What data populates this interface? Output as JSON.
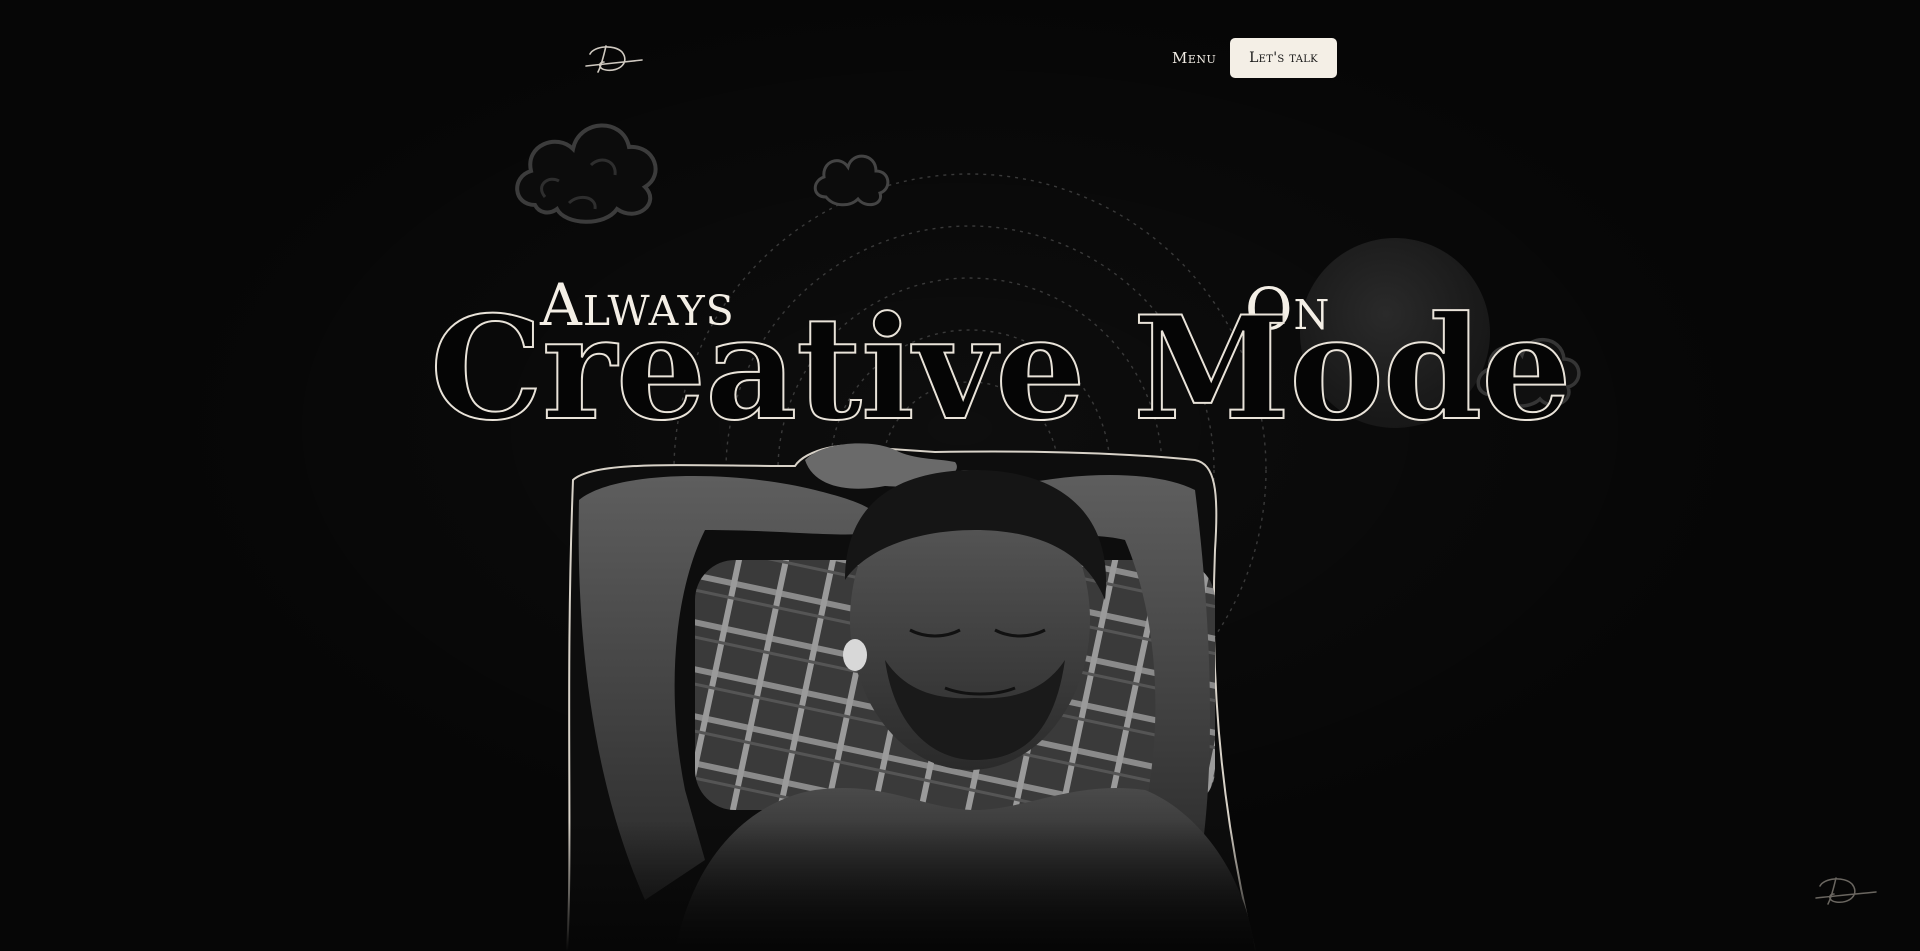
{
  "header": {
    "logo_icon": "signature-logo-icon",
    "menu_label": "Menu",
    "cta_label": "Let's talk"
  },
  "hero": {
    "word_always": "Always",
    "word_on": "On",
    "title": "Creative Mode",
    "photo_icon": "portrait-person-sleeping-image"
  },
  "footer": {
    "signature_icon": "signature-icon"
  },
  "colors": {
    "background": "#060606",
    "text": "#f1ece4",
    "button_bg": "#f4efe6",
    "button_text": "#141414"
  }
}
